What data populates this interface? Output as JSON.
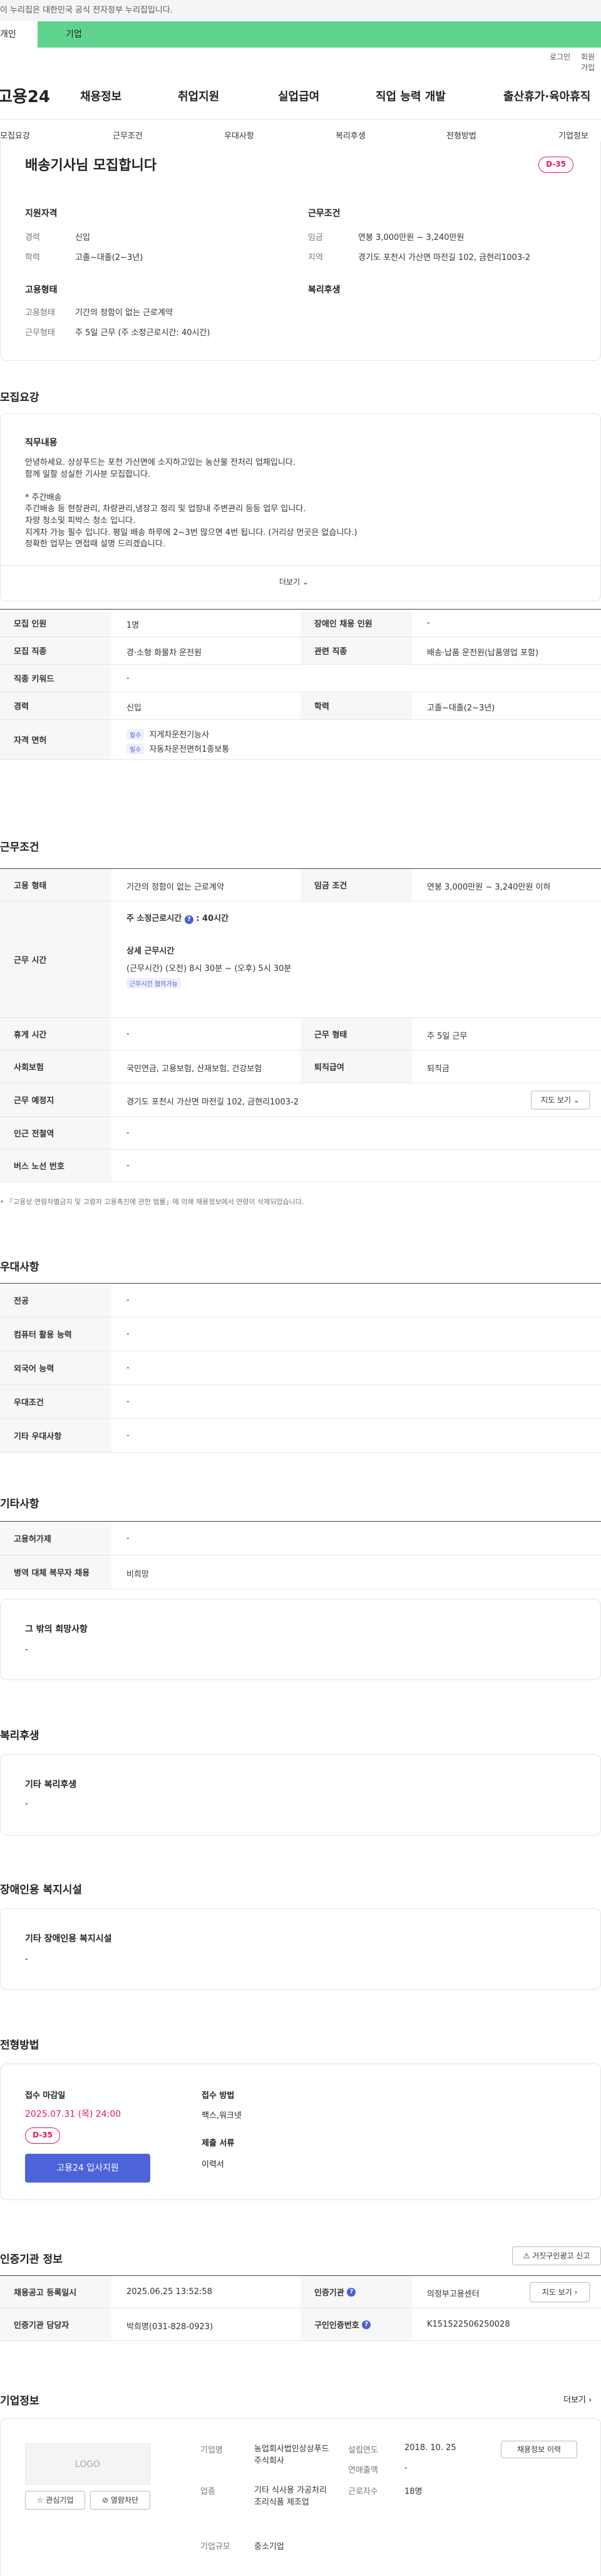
{
  "gov_banner": "이 누리집은 대한민국 공식 전자정부 누리집입니다.",
  "tabs": {
    "personal": "개인",
    "corporate": "기업"
  },
  "util": {
    "login": "로그인",
    "join": "회원가입"
  },
  "header": {
    "logo": "고용24",
    "nav": [
      "채용정보",
      "취업지원",
      "실업급여",
      "직업 능력 개발",
      "출산휴가·육아휴직"
    ]
  },
  "subnav": [
    "모집요강",
    "근무조건",
    "우대사항",
    "복리후생",
    "전형방법",
    "기업정보"
  ],
  "summary": {
    "title": "배송기사님 모집합니다",
    "dday": "D-35",
    "qual_heading": "지원자격",
    "career_label": "경력",
    "career": "신입",
    "edu_label": "학력",
    "edu": "고졸~대졸(2~3년)",
    "cond_heading": "근무조건",
    "wage_label": "임금",
    "wage": "연봉 3,000만원 ~ 3,240만원",
    "region_label": "지역",
    "region": "경기도 포천시 가산면 마전길 102, 금현리1003-2",
    "emp_heading": "고용형태",
    "emptype_label": "고용형태",
    "emptype": "기간의 정함이 없는 근로계약",
    "workform_label": "근무형태",
    "workform": "주 5일 근무 (주 소정근로시간: 40시간)",
    "welfare_heading": "복리후생"
  },
  "recruit": {
    "heading": "모집요강",
    "duty_heading": "직무내용",
    "duty_lines": [
      "안녕하세요. 상상푸드는 포천 가산면에 소지하고있는 농산물 전처리 업체입니다.",
      "함께 일할 성실한 기사분 모집합니다.",
      "",
      "* 주간배송",
      "주간배송 등 현장관리, 차량관리,냉장고 정리 및 업장내 주변관리 등등 업무 입니다.",
      "차량 청소및 피박스 청소 입니다.",
      "지게차 가능 필수 입니다. 평일 배송 하루에 2~3번 많으면 4번 됩니다. (거리상 먼곳은 없습니다.)",
      "정확한 업무는 면접때 설명 드리겠습니다."
    ],
    "more": "더보기",
    "rows": {
      "count_label": "모집 인원",
      "count": "1명",
      "disabled_label": "장애인 채용 인원",
      "disabled": "-",
      "job_label": "모집 직종",
      "job": "경·소형 화물차 운전원",
      "related_label": "관련 직종",
      "related": "배송·납품 운전원(납품영업 포함)",
      "keyword_label": "직종 키워드",
      "keyword": "-",
      "career_label": "경력",
      "career": "신입",
      "edu_label": "학력",
      "edu": "고졸~대졸(2~3년)",
      "license_label": "자격 면허",
      "required_tag": "필수",
      "licenses": [
        "지게차운전기능사",
        "자동차운전면허1종보통"
      ]
    }
  },
  "workcond": {
    "heading": "근무조건",
    "emptype_label": "고용 형태",
    "emptype": "기간의 정함이 없는 근로계약",
    "wage_label": "임금 조건",
    "wage": "연봉 3,000만원 ~ 3,240만원 이하",
    "hours_label": "근무 시간",
    "weekly": "주 소정근로시간",
    "weekly_value": "40시간",
    "detail_title": "상세 근무시간",
    "detail": "(근무시간) (오전) 8시 30분 ~ (오후) 5시 30분",
    "detail_tag": "근무시간 협의가능",
    "rest_label": "휴게 시간",
    "rest": "-",
    "form_label": "근무 형태",
    "form": "주 5일 근무",
    "ins_label": "사회보험",
    "ins": "국민연금, 고용보험, 산재보험, 건강보험",
    "retire_label": "퇴직급여",
    "retire": "퇴직금",
    "place_label": "근무 예정지",
    "place": "경기도 포천시 가산면 마전길 102, 금현리1003-2",
    "map_btn": "지도 보기",
    "subway_label": "인근 전철역",
    "subway": "-",
    "bus_label": "버스 노선 번호",
    "bus": "-",
    "note": "「고용상 연령차별금지 및 고령자 고용촉진에 관한 법률」에 의해 채용정보에서 연령이 삭제되었습니다."
  },
  "pref": {
    "heading": "우대사항",
    "rows": [
      {
        "l": "전공",
        "v": "-"
      },
      {
        "l": "컴퓨터 활용 능력",
        "v": "-"
      },
      {
        "l": "외국어 능력",
        "v": "-"
      },
      {
        "l": "우대조건",
        "v": "-"
      },
      {
        "l": "기타 우대사항",
        "v": "-"
      }
    ]
  },
  "etc": {
    "heading": "기타사항",
    "rows": [
      {
        "l": "고용허가제",
        "v": "-"
      },
      {
        "l": "병역 대체 복무자 채용",
        "v": "비희망"
      }
    ],
    "hope_title": "그 밖의 희망사항",
    "hope": "-"
  },
  "welfare": {
    "heading": "복리후생",
    "box_title": "기타 복리후생",
    "box": "-"
  },
  "disability": {
    "heading": "장애인용 복지시설",
    "box_title": "기타 장애인용 복지시설",
    "box": "-"
  },
  "selection": {
    "heading": "전형방법",
    "deadline_label": "접수 마감일",
    "deadline": "2025.07.31 (목) 24:00",
    "dday": "D-35",
    "apply_btn": "고용24 입사지원",
    "method_label": "접수 방법",
    "method": "팩스,워크넷",
    "docs_label": "제출 서류",
    "docs": "이력서"
  },
  "cert": {
    "heading": "인증기관 정보",
    "report_btn": "거짓구인광고 신고",
    "reg_label": "채용공고 등록일시",
    "reg": "2025.06.25 13:52:58",
    "agency_label": "인증기관",
    "agency": "의정부고용센터",
    "map_btn": "지도 보기",
    "staff_label": "인증기관 담당자",
    "staff": "박희명(031-828-0923)",
    "num_label": "구인인증번호",
    "num": "K151522506250028"
  },
  "company": {
    "heading": "기업정보",
    "more": "더보기",
    "logo": "LOGO",
    "fav_btn": "관심기업",
    "block_btn": "열람차단",
    "name_label": "기업명",
    "name": "농업회사법인상상푸드주식회사",
    "founded_label": "설립연도",
    "founded": "2018. 10. 25",
    "sales_label": "연매출액",
    "sales": "-",
    "biz_label": "업종",
    "biz": "기타 식사용 가공처리 조리식품 제조업",
    "staff_label": "근로자수",
    "staff": "18명",
    "size_label": "기업규모",
    "size": "중소기업",
    "jobs_btn": "채용정보 이력"
  }
}
